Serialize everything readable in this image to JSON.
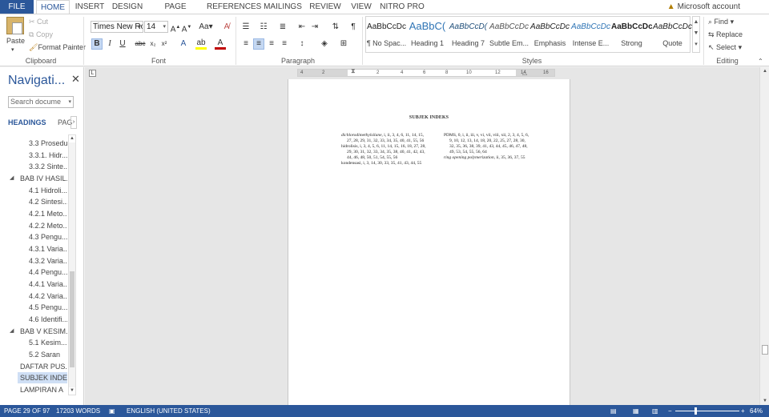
{
  "tabs": [
    "FILE",
    "HOME",
    "INSERT",
    "DESIGN",
    "PAGE LAYOUT",
    "REFERENCES",
    "MAILINGS",
    "REVIEW",
    "VIEW",
    "NITRO PRO"
  ],
  "account": "Microsoft account",
  "clipboard": {
    "paste": "Paste",
    "cut": "Cut",
    "copy": "Copy",
    "format_painter": "Format Painter",
    "label": "Clipboard"
  },
  "font": {
    "name": "Times New Ro",
    "size": "14",
    "label": "Font"
  },
  "paragraph": {
    "label": "Paragraph"
  },
  "styles": {
    "label": "Styles",
    "items": [
      {
        "preview": "AaBbCcDc",
        "name": "¶ No Spac..."
      },
      {
        "preview": "AaBbC(",
        "name": "Heading 1"
      },
      {
        "preview": "AaBbCcD(",
        "name": "Heading 7"
      },
      {
        "preview": "AaBbCcDc",
        "name": "Subtle Em..."
      },
      {
        "preview": "AaBbCcDc",
        "name": "Emphasis"
      },
      {
        "preview": "AaBbCcDc",
        "name": "Intense E..."
      },
      {
        "preview": "AaBbCcDc",
        "name": "Strong"
      },
      {
        "preview": "AaBbCcDc",
        "name": "Quote"
      }
    ]
  },
  "editing": {
    "find": "Find",
    "replace": "Replace",
    "select": "Select",
    "label": "Editing"
  },
  "nav": {
    "title": "Navigati...",
    "search_placeholder": "Search docume",
    "tab_headings": "HEADINGS",
    "tab_pages": "PAG",
    "items": [
      {
        "label": "3.3 Prosedur..."
      },
      {
        "label": "3.3.1. Hidr..."
      },
      {
        "label": "3.3.2 Sinte..."
      },
      {
        "label": "BAB IV HASIL..."
      },
      {
        "label": "4.1 Hidroli..."
      },
      {
        "label": "4.2 Sintesi..."
      },
      {
        "label": "4.2.1 Meto..."
      },
      {
        "label": "4.2.2 Meto..."
      },
      {
        "label": "4.3 Pengu..."
      },
      {
        "label": "4.3.1 Varia..."
      },
      {
        "label": "4.3.2 Varia..."
      },
      {
        "label": "4.4 Pengu..."
      },
      {
        "label": "4.4.1 Varia..."
      },
      {
        "label": "4.4.2 Varia..."
      },
      {
        "label": "4.5 Pengu..."
      },
      {
        "label": "4.6 Identifi..."
      },
      {
        "label": "BAB V KESIM..."
      },
      {
        "label": "5.1 Kesim..."
      },
      {
        "label": "5.2 Saran"
      },
      {
        "label": "DAFTAR PUS..."
      },
      {
        "label": "SUBJEK INDEKS"
      },
      {
        "label": "LAMPIRAN A"
      }
    ]
  },
  "ruler": [
    "4",
    "2",
    "2",
    "4",
    "6",
    "8",
    "10",
    "12",
    "14",
    "16"
  ],
  "document": {
    "title": "SUBJEK INDEKS",
    "left_col": [
      {
        "term": "dichlorodimethylsilane",
        "italic": true,
        "pages": ", i, ii, 3, 4, 6, 11, 14, 15, 27, 28, 29, 31, 32, 33, 34, 35, 40, 41, 55, 56"
      },
      {
        "term": "hidrolisis",
        "italic": false,
        "pages": ", i, 3, 4, 5, 6, 11, 14, 15, 16, 18, 27, 28, 29, 30, 31, 32, 33, 34, 35, 38, 40, 41, 42, 43, 44, 46, 48, 50, 51, 54, 55, 56"
      },
      {
        "term": "kondensasi",
        "italic": false,
        "pages": ", i, 3, 14, 30, 33, 35, 41, 43, 44, 55"
      }
    ],
    "right_col": [
      {
        "term": "PDMS",
        "italic": false,
        "pages": ", 0, i, ii, iii, v, vi, vii, viii, xii, 2, 3, 4, 5, 6, 9, 10, 12, 13, 14, 18, 20, 22, 25, 27, 28, 30, 32, 35, 36, 38, 39, 41, 43, 44, 45, 46, 47, 48, 49, 53, 54, 55, 56, 64"
      },
      {
        "term": "ring opening polymerization",
        "italic": true,
        "pages": ", ii, 35, 36, 37, 55"
      }
    ]
  },
  "status": {
    "page": "PAGE 29 OF 97",
    "words": "17203 WORDS",
    "language": "ENGLISH (UNITED STATES)",
    "zoom": "64%"
  },
  "colors": {
    "accent": "#2b579a",
    "nav_selected": "#cfdff5"
  }
}
